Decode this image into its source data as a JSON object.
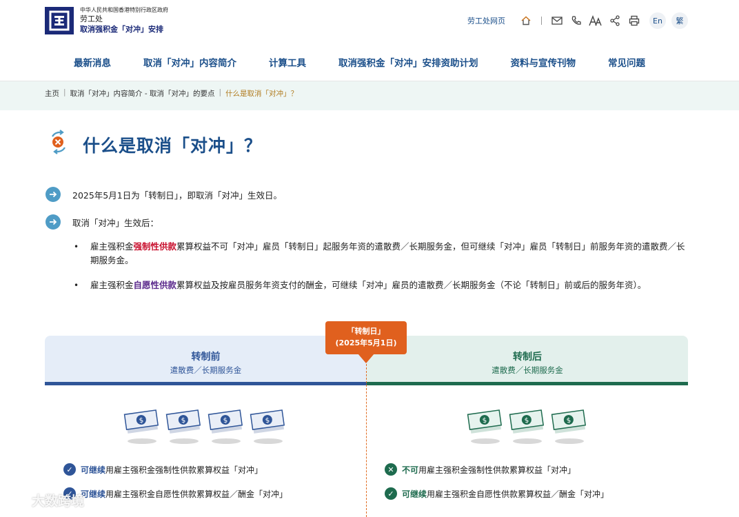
{
  "header": {
    "gov_line": "中华人民共和国香港特别行政区政府",
    "dept": "劳工处",
    "site": "取消强积金「对冲」安排",
    "home_link": "劳工处网页",
    "lang_en": "En",
    "lang_trad": "繁"
  },
  "nav": {
    "items": [
      {
        "label": "最新消息"
      },
      {
        "label": "取消「对冲」内容简介"
      },
      {
        "label": "计算工具"
      },
      {
        "label": "取消强积金「对冲」安排资助计划"
      },
      {
        "label": "资料与宣传刊物"
      },
      {
        "label": "常见问题"
      }
    ]
  },
  "breadcrumb": {
    "home": "主页",
    "level1": "取消「对冲」内容简介 - 取消「对冲」的要点",
    "current": "什么是取消「对冲」？"
  },
  "page": {
    "title": "什么是取消「对冲」？",
    "point1": "2025年5月1日为「转制日」，即取消「对冲」生效日。",
    "point2": "取消「对冲」生效后：",
    "bullet1": {
      "pre": "雇主强积金",
      "highlight": "强制性供款",
      "post": "累算权益不可「对冲」雇员「转制日」起服务年资的遣散费／长期服务金，但可继续「对冲」雇员「转制日」前服务年资的遣散费／长期服务金。"
    },
    "bullet2": {
      "pre": "雇主强积金",
      "highlight": "自愿性供款",
      "post": "累算权益及按雇员服务年资支付的酬金，可继续「对冲」雇员的遣散费／长期服务金（不论「转制日」前或后的服务年资）。"
    }
  },
  "comparison": {
    "flag_line1": "「转制日」",
    "flag_line2": "(2025年5月1日)",
    "before": {
      "title": "转制前",
      "sub": "遣散费／长期服务金",
      "row1_strong": "可继续",
      "row1_text": "用雇主强积金强制性供款累算权益「对冲」",
      "row2_strong": "可继续",
      "row2_text": "用雇主强积金自愿性供款累算权益／酬金「对冲」"
    },
    "after": {
      "title": "转制后",
      "sub": "遣散费／长期服务金",
      "row1_strong": "不可",
      "row1_text": "用雇主强积金强制性供款累算权益「对冲」",
      "row2_strong": "可继续",
      "row2_text": "用雇主强积金自愿性供款累算权益／酬金「对冲」"
    }
  },
  "watermark": "大数跨境",
  "colors": {
    "brand_blue": "#1b4f8a",
    "before_blue": "#2f5598",
    "after_green": "#1e6b4e",
    "accent_orange": "#e0601e"
  }
}
